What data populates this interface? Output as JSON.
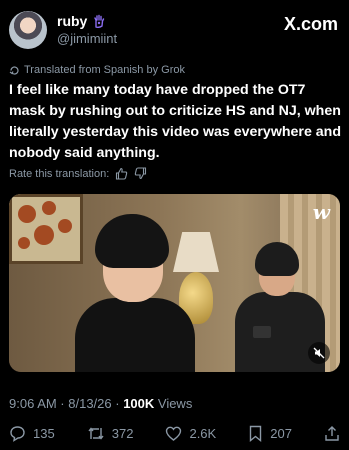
{
  "tweet": {
    "display_name": "ruby",
    "handle": "@jimimiint",
    "brand": "X.com",
    "translated_label": "Translated from Spanish by Grok",
    "text": "I feel like many today have dropped the OT7 mask by rushing out to criticize HS and NJ, when literally yesterday this video was everywhere and nobody said anything.",
    "rate_label": "Rate this translation:",
    "timestamp": "9:06 AM · 8/13/26 · ",
    "views_count": "100K",
    "views_label": " Views",
    "media_logo": "w"
  },
  "actions": {
    "replies": "135",
    "reposts": "372",
    "likes": "2.6K",
    "bookmarks": "207"
  },
  "icons": [
    "purple-hand-badge-icon",
    "x-logo-icon",
    "translate-icon",
    "thumbs-up-icon",
    "thumbs-down-icon",
    "mute-icon",
    "reply-icon",
    "repost-icon",
    "like-icon",
    "bookmark-icon",
    "share-icon"
  ],
  "colors": {
    "background": "#000000",
    "text": "#e7e9ea",
    "secondary": "#8b98a5",
    "badge": "#8a6cf0"
  }
}
